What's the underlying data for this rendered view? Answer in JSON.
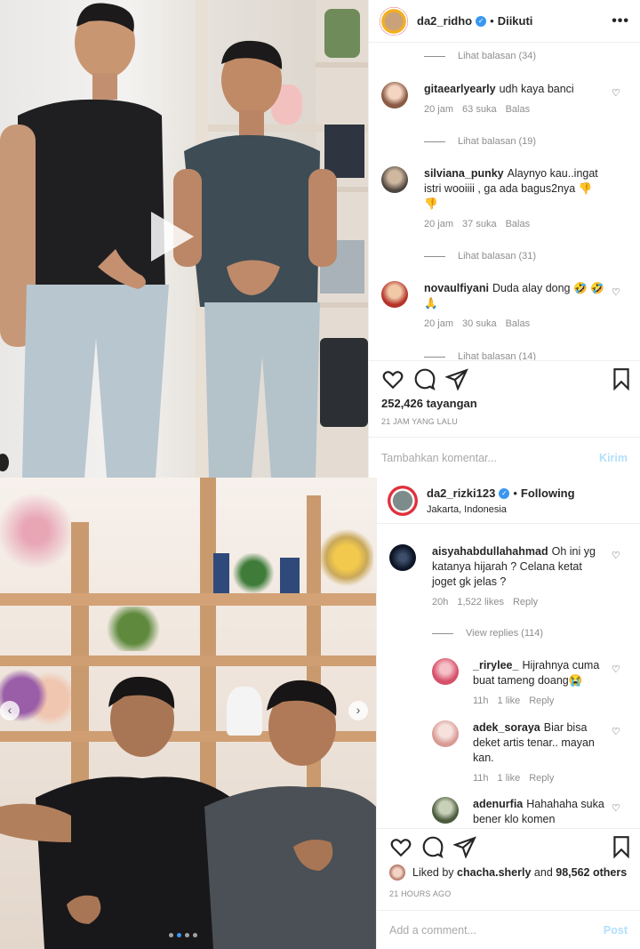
{
  "post1": {
    "username": "da2_ridho",
    "follow_status": "Diikuti",
    "comments": [
      {
        "user": "gitaearlyearly",
        "text": "udh kaya banci",
        "time": "20 jam",
        "likes": "63 suka",
        "reply": "Balas",
        "avatar_color": "#d9a58c"
      },
      {
        "user": "silviana_punky",
        "text": "Alaynyo kau..ingat istri wooiiii , ga ada bagus2nya 👎 👎",
        "time": "20 jam",
        "likes": "37 suka",
        "reply": "Balas",
        "avatar_color": "#7a6a5c"
      },
      {
        "user": "novaulfiyani",
        "text": "Duda alay dong 🤣 🤣 🙏",
        "time": "20 jam",
        "likes": "30 suka",
        "reply": "Balas",
        "avatar_color": "#c44a3a"
      }
    ],
    "view_replies": [
      "Lihat balasan (34)",
      "Lihat balasan (19)",
      "Lihat balasan (31)",
      "Lihat balasan (14)"
    ],
    "views": "252,426 tayangan",
    "timestamp": "21 JAM YANG LALU",
    "add_comment_placeholder": "Tambahkan komentar...",
    "post_label": "Kirim"
  },
  "post2": {
    "username": "da2_rizki123",
    "follow_status": "Following",
    "location": "Jakarta, Indonesia",
    "comments": [
      {
        "user": "aisyahabdullahahmad",
        "text": "Oh ini yg katanya hijarah ? Celana ketat joget gk jelas ?",
        "time": "20h",
        "likes": "1,522 likes",
        "reply": "Reply",
        "avatar_color": "#1b2740"
      },
      {
        "user": "_rirylee_",
        "text": "Hijrahnya cuma buat tameng doang😭",
        "time": "11h",
        "likes": "1 like",
        "reply": "Reply",
        "avatar_color": "#e07a8a"
      },
      {
        "user": "adek_soraya",
        "text": "Biar bisa deket artis tenar.. mayan kan.",
        "time": "11h",
        "likes": "1 like",
        "reply": "Reply",
        "avatar_color": "#e8b4b0"
      },
      {
        "user": "adenurfia",
        "text": "Hahahaha suka bener klo komen",
        "avatar_color": "#6b7d5c"
      }
    ],
    "view_replies": "View replies (114)",
    "liked_by_prefix": "Liked by",
    "liked_by_user": "chacha.sherly",
    "liked_by_and": "and",
    "liked_by_others": "98,562 others",
    "timestamp": "21 HOURS AGO",
    "add_comment_placeholder": "Add a comment...",
    "post_label": "Post"
  }
}
